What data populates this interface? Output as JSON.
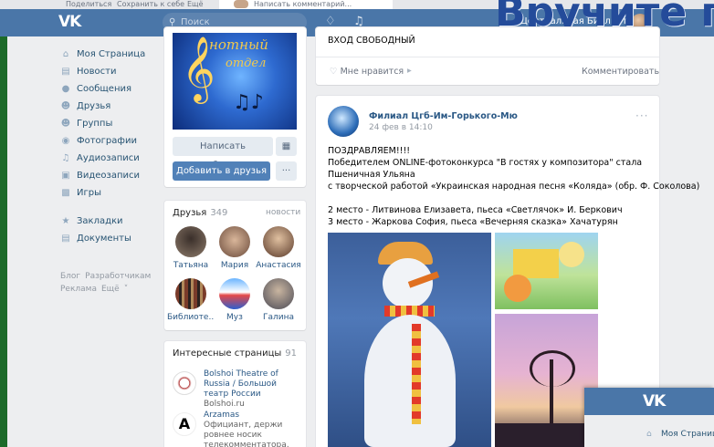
{
  "top_strip": {
    "share": "Поделиться",
    "save": "Сохранить к себе",
    "more": "Ещё",
    "write_comment": "Написать комментарий..."
  },
  "header": {
    "search_placeholder": "Поиск",
    "user_name": "Центральная Библиотека",
    "overlay_title": "Вручите г"
  },
  "sidebar": {
    "items": [
      {
        "label": "Моя Страница",
        "icon": "home-icon"
      },
      {
        "label": "Новости",
        "icon": "news-icon"
      },
      {
        "label": "Сообщения",
        "icon": "messages-icon"
      },
      {
        "label": "Друзья",
        "icon": "friends-icon"
      },
      {
        "label": "Группы",
        "icon": "groups-icon"
      },
      {
        "label": "Фотографии",
        "icon": "camera-icon"
      },
      {
        "label": "Аудиозаписи",
        "icon": "music-icon"
      },
      {
        "label": "Видеозаписи",
        "icon": "video-icon"
      },
      {
        "label": "Игры",
        "icon": "gamepad-icon"
      }
    ],
    "items2": [
      {
        "label": "Закладки",
        "icon": "star-icon"
      },
      {
        "label": "Документы",
        "icon": "document-icon"
      }
    ],
    "footer": {
      "blog": "Блог",
      "dev": "Разработчикам",
      "ads": "Реклама",
      "more": "Ещё"
    }
  },
  "profile": {
    "cover_text_1": "нотный",
    "cover_text_2": "отдел",
    "write_message": "Написать сообщение",
    "add_friend": "Добавить в друзья"
  },
  "friends": {
    "title": "Друзья",
    "count": "349",
    "updates": "новости",
    "items": [
      {
        "name": "Татьяна"
      },
      {
        "name": "Мария"
      },
      {
        "name": "Анастасия"
      },
      {
        "name": "Библиоте..."
      },
      {
        "name": "Муз"
      },
      {
        "name": "Галина"
      }
    ]
  },
  "interesting": {
    "title": "Интересные страницы",
    "count": "91",
    "items": [
      {
        "name": "Bolshoi Theatre of Russia / Большой театр России",
        "sub": "Bolshoi.ru"
      },
      {
        "name": "Arzamas",
        "sub": "Официант, держи ровнее носик телекомментатора,"
      }
    ]
  },
  "post1": {
    "text": "ВХОД СВОБОДНЫЙ",
    "like": "Мне нравится",
    "comment": "Комментировать"
  },
  "post2": {
    "author": "Филиал Цгб-Им-Горького-Мю",
    "date": "24 фев в 14:10",
    "lines": [
      "ПОЗДРАВЛЯЕМ!!!!",
      "Победителем ONLINE-фотоконкурса \"В гостях у композитора\" стала",
      "Пшеничная Ульяна",
      "с творческой работой «Украинская народная песня «Коляда» (обр. Ф. Соколова)",
      "2 место - Литвинова Елизавета, пьеса «Светлячок» И. Беркович",
      "3 место - Жаркова София, пьеса «Вечерняя сказка» Хачатурян"
    ]
  },
  "mini_window": {
    "item": "Моя Страница"
  }
}
